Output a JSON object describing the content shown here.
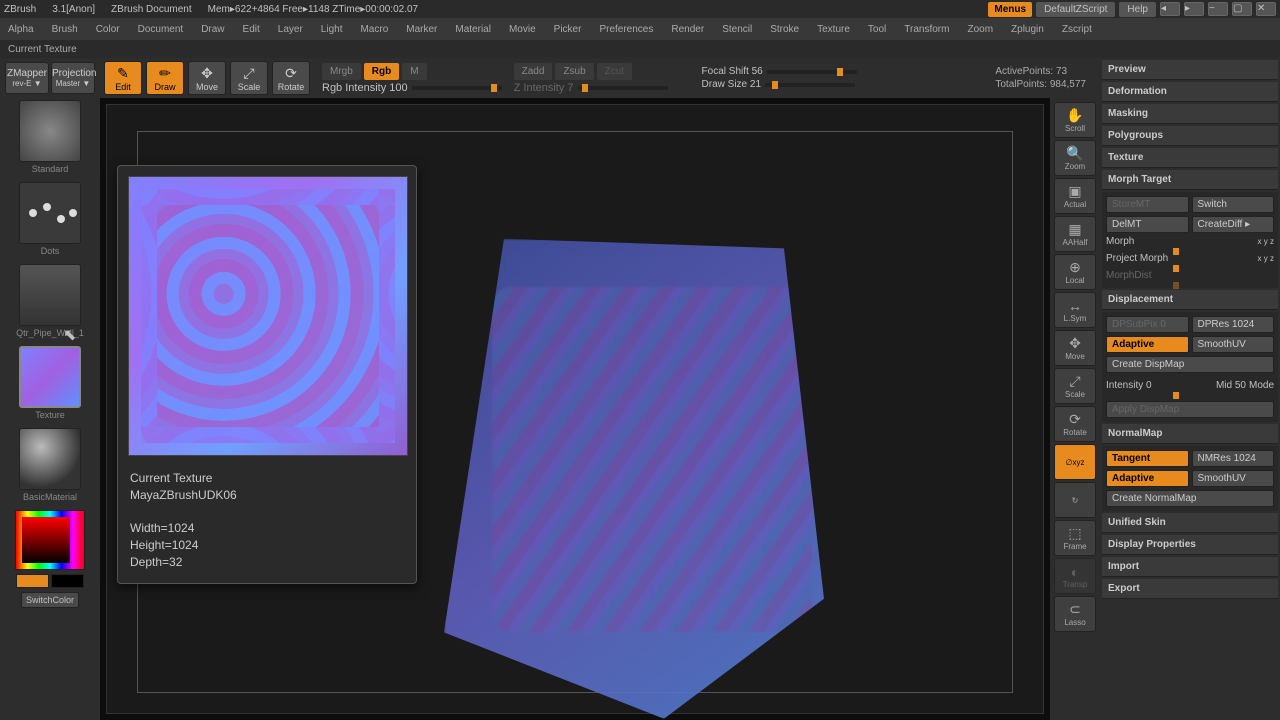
{
  "app": {
    "name": "ZBrush",
    "version": "3.1[Anon]",
    "doc_title": "ZBrush Document",
    "mem": "Mem▸622+4864 Free▸1148 ZTime▸00:00:02.07"
  },
  "titlebar": {
    "menus": "Menus",
    "defaultscript": "DefaultZScript",
    "help": "Help"
  },
  "statusbar": {
    "text": "Current Texture"
  },
  "menubar": [
    "Alpha",
    "Brush",
    "Color",
    "Document",
    "Draw",
    "Edit",
    "Layer",
    "Light",
    "Macro",
    "Marker",
    "Material",
    "Movie",
    "Picker",
    "Preferences",
    "Render",
    "Stencil",
    "Stroke",
    "Texture",
    "Tool",
    "Transform",
    "Zoom",
    "Zplugin",
    "Zscript"
  ],
  "left": {
    "zmapper": "ZMapper",
    "zmapper_sub": "rev-E ▼",
    "projmaster": "Projection",
    "projmaster_sub": "Master ▼",
    "standard": "Standard",
    "dots": "Dots",
    "pipe": "Qtr_Pipe_Wall_1",
    "texture": "Texture",
    "material": "BasicMaterial",
    "switchcolor": "SwitchColor"
  },
  "toolbar": {
    "edit": "Edit",
    "draw": "Draw",
    "move": "Move",
    "scale": "Scale",
    "rotate": "Rotate",
    "mrgb": "Mrgb",
    "rgb": "Rgb",
    "m": "M",
    "zadd": "Zadd",
    "zsub": "Zsub",
    "zcut": "Zcut",
    "rgb_intensity": "Rgb Intensity 100",
    "z_intensity": "Z Intensity 7",
    "focal": "Focal Shift 56",
    "drawsize": "Draw Size 21",
    "activepts": "ActivePoints: 73",
    "totalpts": "TotalPoints: 984,577"
  },
  "right_tools": [
    "Scroll",
    "Zoom",
    "Actual",
    "AAHalf",
    "Local",
    "L.Sym",
    "Move",
    "Scale",
    "Rotate",
    "∅xyz",
    "↻",
    "Frame",
    "Transp",
    "Lasso"
  ],
  "right_panel": {
    "preview": "Preview",
    "deformation": "Deformation",
    "masking": "Masking",
    "polygroups": "Polygroups",
    "texture": "Texture",
    "morph_target": {
      "title": "Morph Target",
      "storemt": "StoreMT",
      "switch": "Switch",
      "delmt": "DelMT",
      "creatediff": "CreateDiff ▸",
      "morph": "Morph",
      "morph_xyz": "x y z",
      "project": "Project Morph",
      "project_xyz": "x y z",
      "morphdist": "MorphDist"
    },
    "displacement": {
      "title": "Displacement",
      "dpsubpix": "DPSubPix 0",
      "dpres": "DPRes 1024",
      "adaptive": "Adaptive",
      "smoothuv": "SmoothUV",
      "create": "Create DispMap",
      "intensity": "Intensity 0",
      "mid": "Mid 50",
      "mode": "Mode",
      "apply": "Apply DispMap"
    },
    "normalmap": {
      "title": "NormalMap",
      "tangent": "Tangent",
      "nmres": "NMRes 1024",
      "adaptive": "Adaptive",
      "smoothuv": "SmoothUV",
      "create": "Create NormalMap"
    },
    "unified": "Unified Skin",
    "display": "Display Properties",
    "import": "Import",
    "export": "Export"
  },
  "tooltip": {
    "title": "Current Texture",
    "name": "MayaZBrushUDK06",
    "width": "Width=1024",
    "height": "Height=1024",
    "depth": "Depth=32"
  }
}
